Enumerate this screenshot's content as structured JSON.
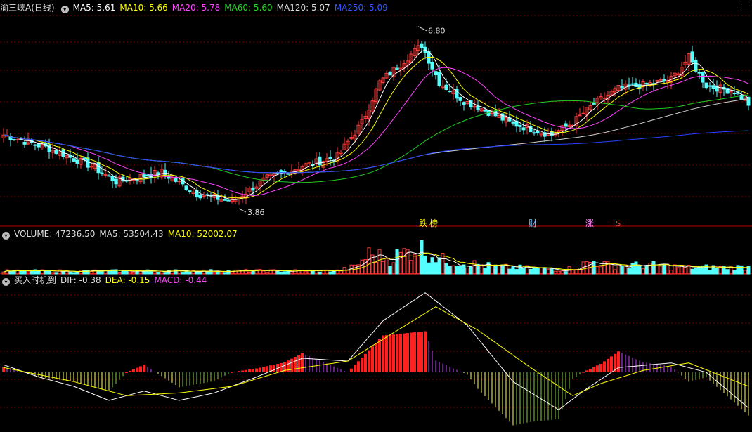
{
  "main_legend": {
    "stock": "渝三峡A",
    "period": "(日线)",
    "ma5": "MA5: 5.61",
    "ma10": "MA10: 5.66",
    "ma20": "MA20: 5.78",
    "ma60": "MA60: 5.60",
    "ma120": "MA120: 5.07",
    "ma250": "MA250: 5.09"
  },
  "volume_legend": {
    "title": "VOLUME: 47236.50",
    "ma5": "MA5: 53504.43",
    "ma10": "MA10: 52002.07"
  },
  "macd_legend": {
    "title": "买入时机到",
    "dif": "DIF: -0.38",
    "dea": "DEA: -0.15",
    "macd": "MACD: -0.44"
  },
  "events": [
    "跌",
    "榜",
    "财",
    "涨",
    "$"
  ],
  "annotations": {
    "high": "6.80",
    "low": "3.86"
  },
  "colors": {
    "up": "#ff3b3b",
    "down": "#54ffff",
    "ma5": "#ffffff",
    "ma10": "#ffff00",
    "ma20": "#ff44ff",
    "ma60": "#22cc22",
    "ma120": "#d0d0d0",
    "ma250": "#2244ff",
    "grid": "#7a0000",
    "divider": "#c00000"
  },
  "chart_data": [
    {
      "type": "candlestick",
      "title": "渝三峡A (日线)",
      "ylim": [
        3.6,
        7.0
      ],
      "high_label": 6.8,
      "low_label": 3.86,
      "close_anchors": [
        [
          0,
          5.05
        ],
        [
          12,
          4.85
        ],
        [
          25,
          4.55
        ],
        [
          32,
          4.3
        ],
        [
          45,
          4.45
        ],
        [
          55,
          4.1
        ],
        [
          65,
          3.98
        ],
        [
          75,
          4.35
        ],
        [
          85,
          4.55
        ],
        [
          95,
          4.7
        ],
        [
          102,
          5.25
        ],
        [
          107,
          5.9
        ],
        [
          113,
          6.2
        ],
        [
          119,
          6.5
        ],
        [
          124,
          5.9
        ],
        [
          131,
          5.6
        ],
        [
          137,
          5.45
        ],
        [
          144,
          5.25
        ],
        [
          156,
          5.05
        ],
        [
          162,
          5.25
        ],
        [
          168,
          5.55
        ],
        [
          175,
          5.8
        ],
        [
          182,
          5.85
        ],
        [
          190,
          5.95
        ],
        [
          195,
          6.3
        ],
        [
          200,
          5.85
        ],
        [
          208,
          5.75
        ],
        [
          212,
          5.55
        ]
      ],
      "candle_count": 213,
      "ma_lines": [
        {
          "name": "MA5",
          "value": 5.61
        },
        {
          "name": "MA10",
          "value": 5.66
        },
        {
          "name": "MA20",
          "value": 5.78
        },
        {
          "name": "MA60",
          "value": 5.6
        },
        {
          "name": "MA120",
          "value": 5.07
        },
        {
          "name": "MA250",
          "value": 5.09
        }
      ]
    },
    {
      "type": "bar",
      "title": "VOLUME",
      "latest": 47236.5,
      "ma5": 53504.43,
      "ma10": 52002.07,
      "ylim": [
        0,
        250000
      ],
      "volume_anchors": [
        [
          0,
          20000
        ],
        [
          95,
          22000
        ],
        [
          100,
          50000
        ],
        [
          104,
          140000
        ],
        [
          110,
          110000
        ],
        [
          118,
          190000
        ],
        [
          125,
          100000
        ],
        [
          140,
          50000
        ],
        [
          160,
          30000
        ],
        [
          168,
          90000
        ],
        [
          172,
          60000
        ],
        [
          185,
          60000
        ],
        [
          195,
          45000
        ],
        [
          212,
          47236
        ]
      ]
    },
    {
      "type": "bar",
      "title": "买入时机到",
      "DIF": -0.38,
      "DEA": -0.15,
      "MACD": -0.44,
      "ylim": [
        -0.8,
        0.9
      ],
      "dif_anchors": [
        [
          0,
          0.08
        ],
        [
          10,
          -0.05
        ],
        [
          20,
          -0.15
        ],
        [
          30,
          -0.3
        ],
        [
          40,
          -0.2
        ],
        [
          50,
          -0.3
        ],
        [
          60,
          -0.22
        ],
        [
          72,
          -0.05
        ],
        [
          85,
          0.15
        ],
        [
          98,
          0.12
        ],
        [
          108,
          0.55
        ],
        [
          120,
          0.85
        ],
        [
          132,
          0.5
        ],
        [
          145,
          -0.1
        ],
        [
          158,
          -0.4
        ],
        [
          165,
          -0.2
        ],
        [
          175,
          0.05
        ],
        [
          190,
          0.1
        ],
        [
          200,
          0.0
        ],
        [
          212,
          -0.38
        ]
      ],
      "dea_anchors": [
        [
          0,
          0.05
        ],
        [
          20,
          -0.1
        ],
        [
          35,
          -0.25
        ],
        [
          50,
          -0.22
        ],
        [
          65,
          -0.15
        ],
        [
          80,
          0.02
        ],
        [
          98,
          0.12
        ],
        [
          110,
          0.4
        ],
        [
          123,
          0.7
        ],
        [
          135,
          0.45
        ],
        [
          150,
          0.05
        ],
        [
          162,
          -0.25
        ],
        [
          170,
          -0.12
        ],
        [
          182,
          0.02
        ],
        [
          195,
          0.1
        ],
        [
          212,
          -0.15
        ]
      ]
    }
  ]
}
